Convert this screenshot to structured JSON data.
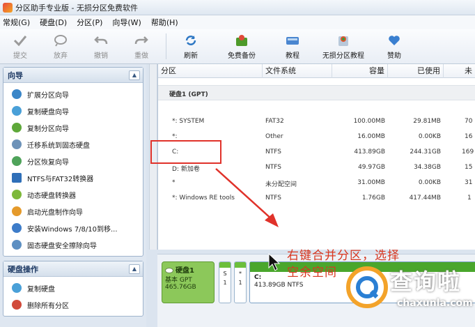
{
  "window": {
    "title": "分区助手专业版 - 无损分区免费软件"
  },
  "menu": [
    "常规(G)",
    "硬盘(D)",
    "分区(P)",
    "向导(W)",
    "帮助(H)"
  ],
  "toolbar": {
    "commit": "提交",
    "discard": "放弃",
    "undo": "撤销",
    "redo": "重做",
    "refresh": "刷新",
    "free_backup": "免费备份",
    "tutorial": "教程",
    "lossless_tutorial": "无损分区教程",
    "donate": "赞助"
  },
  "sidebar": {
    "wizard_title": "向导",
    "wizards": [
      "扩展分区向导",
      "复制硬盘向导",
      "复制分区向导",
      "迁移系统到固态硬盘",
      "分区恢复向导",
      "NTFS与FAT32转换器",
      "动态硬盘转换器",
      "启动光盘制作向导",
      "安装Windows 7/8/10到移...",
      "固态硬盘安全擦除向导"
    ],
    "disk_ops_title": "硬盘操作",
    "disk_ops": [
      "复制硬盘",
      "删除所有分区"
    ]
  },
  "table": {
    "headers": [
      "分区",
      "文件系统",
      "容量",
      "已使用",
      "未"
    ],
    "disk_label": "硬盘1 (GPT)",
    "rows": [
      {
        "name": "*: SYSTEM",
        "fs": "FAT32",
        "cap": "100.00MB",
        "used": "29.81MB",
        "free": "70"
      },
      {
        "name": "*:",
        "fs": "Other",
        "cap": "16.00MB",
        "used": "0.00KB",
        "free": "16"
      },
      {
        "name": "C:",
        "fs": "NTFS",
        "cap": "413.89GB",
        "used": "244.31GB",
        "free": "169"
      },
      {
        "name": "D: 新加卷",
        "fs": "NTFS",
        "cap": "49.97GB",
        "used": "34.38GB",
        "free": "15"
      },
      {
        "name": "*",
        "fs": "未分配空间",
        "cap": "31.00MB",
        "used": "0.00KB",
        "free": "31"
      },
      {
        "name": "*: Windows RE tools",
        "fs": "NTFS",
        "cap": "1.76GB",
        "used": "417.44MB",
        "free": "1"
      }
    ]
  },
  "diskmap": {
    "disk_name": "硬盘1",
    "disk_type": "基本 GPT",
    "disk_size": "465.76GB",
    "p1_letter": "S",
    "p1_size": "1",
    "p2_letter": "*",
    "p2_size": "1",
    "c_name": "C:",
    "c_desc": "413.89GB NTFS"
  },
  "annotation": {
    "line1": "右键合并分区，选择",
    "line2": "空余空间"
  },
  "watermark": {
    "cn": "查询啦",
    "en": "chaxunla.com"
  },
  "colors": {
    "accent_red": "#e0322a",
    "partition_green": "#4aa62c",
    "watermark_orange": "#f3a32a"
  }
}
